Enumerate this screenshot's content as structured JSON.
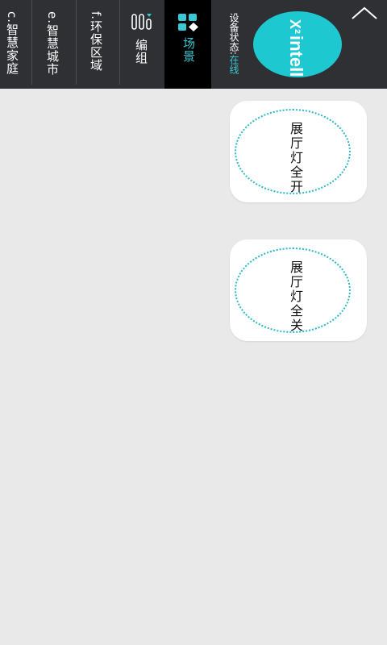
{
  "tabs": {
    "smart_home": "c.智慧家庭",
    "smart_city": "e.智慧城市",
    "env_area": "f.环保区域",
    "group": "编组",
    "scene": "场景"
  },
  "device_status": {
    "label": "设备状态:",
    "value": "在线"
  },
  "logo": {
    "text": "intelli",
    "mark": "X²"
  },
  "scenes": [
    {
      "label": "展厅灯全开"
    },
    {
      "label": "展厅灯全关"
    }
  ],
  "colors": {
    "accent": "#39c9d4",
    "topbar_bg": "#2e3033",
    "active_tab_bg": "#000000",
    "page_bg": "#e9e9e9"
  },
  "icons": {
    "group": "group-list-icon",
    "scene": "scene-icon",
    "collapse": "chevron-up-icon"
  }
}
